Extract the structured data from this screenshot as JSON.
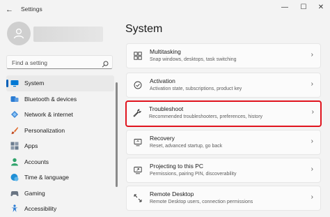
{
  "window": {
    "title": "Settings",
    "back_glyph": "←",
    "minimize_glyph": "—",
    "maximize_glyph": "☐",
    "close_glyph": "✕"
  },
  "search": {
    "placeholder": "Find a setting"
  },
  "sidebar": {
    "items": [
      {
        "label": "System",
        "icon": "monitor-icon",
        "active": true
      },
      {
        "label": "Bluetooth & devices",
        "icon": "bluetooth-icon"
      },
      {
        "label": "Network & internet",
        "icon": "network-icon"
      },
      {
        "label": "Personalization",
        "icon": "paintbrush-icon"
      },
      {
        "label": "Apps",
        "icon": "apps-icon"
      },
      {
        "label": "Accounts",
        "icon": "person-icon"
      },
      {
        "label": "Time & language",
        "icon": "globe-clock-icon"
      },
      {
        "label": "Gaming",
        "icon": "gamepad-icon"
      },
      {
        "label": "Accessibility",
        "icon": "accessibility-icon"
      }
    ]
  },
  "main": {
    "title": "System",
    "cards": [
      {
        "title": "Multitasking",
        "desc": "Snap windows, desktops, task switching",
        "icon": "multitasking-icon"
      },
      {
        "title": "Activation",
        "desc": "Activation state, subscriptions, product key",
        "icon": "check-circle-icon"
      },
      {
        "title": "Troubleshoot",
        "desc": "Recommended troubleshooters, preferences, history",
        "icon": "wrench-icon",
        "highlighted": true
      },
      {
        "title": "Recovery",
        "desc": "Reset, advanced startup, go back",
        "icon": "recovery-icon"
      },
      {
        "title": "Projecting to this PC",
        "desc": "Permissions, pairing PIN, discoverability",
        "icon": "projector-icon"
      },
      {
        "title": "Remote Desktop",
        "desc": "Remote Desktop users, connection permissions",
        "icon": "remote-desktop-icon"
      }
    ]
  },
  "colors": {
    "accent": "#005fb8",
    "highlight_border": "#e0141e",
    "background": "#f3f3f3"
  }
}
